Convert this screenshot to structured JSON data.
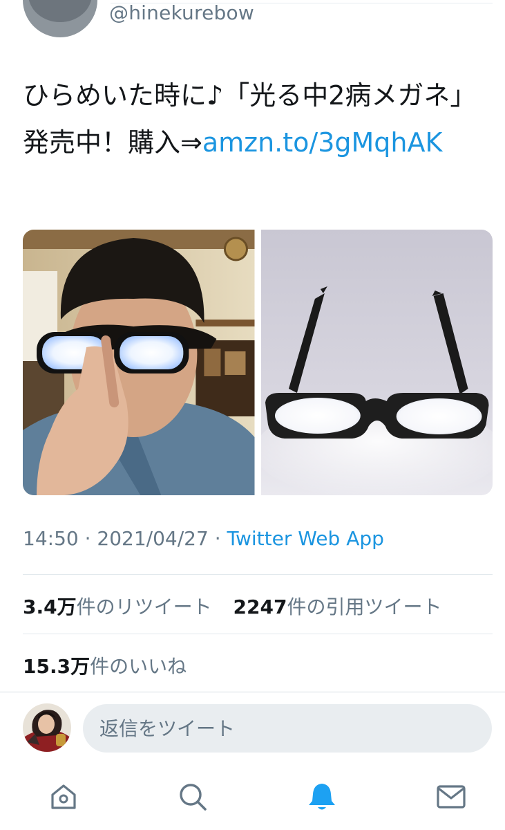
{
  "header": {
    "handle": "@hinekurebow"
  },
  "tweet": {
    "text": "ひらめいた時に♪「光る中2病メガネ」発売中！購入⇒",
    "link_text": "amzn.to/3gMqhAK"
  },
  "media": [
    {
      "name": "photo-person-wearing-glowing-glasses"
    },
    {
      "name": "photo-glowing-glasses-product"
    }
  ],
  "meta": {
    "time": "14:50",
    "separator": " · ",
    "date": "2021/04/27",
    "app": "Twitter Web App"
  },
  "stats": {
    "retweets_count": "3.4万",
    "retweets_label": "件のリツイート",
    "quotes_count": "2247",
    "quotes_label": "件の引用ツイート",
    "likes_count": "15.3万",
    "likes_label": "件のいいね"
  },
  "reply": {
    "placeholder": "返信をツイート"
  },
  "nav": {
    "items": [
      {
        "icon": "home-icon"
      },
      {
        "icon": "search-icon"
      },
      {
        "icon": "notifications-bell-icon",
        "active": true
      },
      {
        "icon": "messages-envelope-icon"
      }
    ]
  },
  "colors": {
    "link": "#1b95e0",
    "secondary_text": "#657786",
    "primary_text": "#14171a",
    "active_nav": "#1da1f2",
    "inactive_nav": "#657786"
  }
}
